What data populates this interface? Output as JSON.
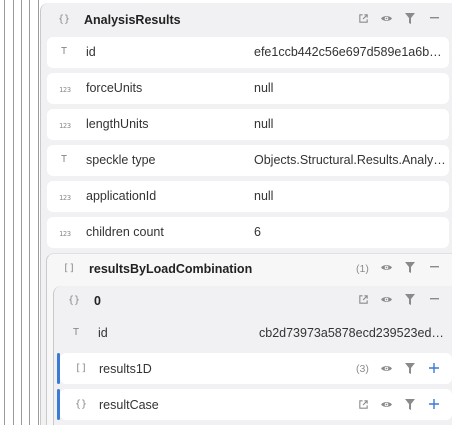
{
  "root": {
    "title": "AnalysisResults",
    "type_icon": "{}",
    "fields": [
      {
        "icon": "T",
        "key": "id",
        "value": "efe1ccb442c56e697d589e1a6b…"
      },
      {
        "icon": "123",
        "key": "forceUnits",
        "value": "null"
      },
      {
        "icon": "123",
        "key": "lengthUnits",
        "value": "null"
      },
      {
        "icon": "T",
        "key": "speckle type",
        "value": "Objects.Structural.Results.Analy…"
      },
      {
        "icon": "123",
        "key": "applicationId",
        "value": "null"
      },
      {
        "icon": "123",
        "key": "children count",
        "value": "6"
      }
    ]
  },
  "results_by_load": {
    "title": "resultsByLoadCombination",
    "type_icon": "[]",
    "count": "(1)"
  },
  "item0": {
    "title": "0",
    "type_icon": "{}",
    "id_row": {
      "icon": "T",
      "key": "id",
      "value": "cb2d73973a5878ecd239523ed…"
    },
    "results1d": {
      "icon": "[]",
      "key": "results1D",
      "count": "(3)"
    },
    "resultcase": {
      "icon": "{}",
      "key": "resultCase"
    }
  },
  "icons": {
    "open": "external-link-icon",
    "view": "eye-icon",
    "filter": "filter-icon",
    "collapse": "minus-icon",
    "expand": "plus-icon"
  },
  "colors": {
    "accent": "#3a7bd5",
    "panel_bg": "#f1f1f3",
    "icon_grey": "#8a8a8a"
  }
}
